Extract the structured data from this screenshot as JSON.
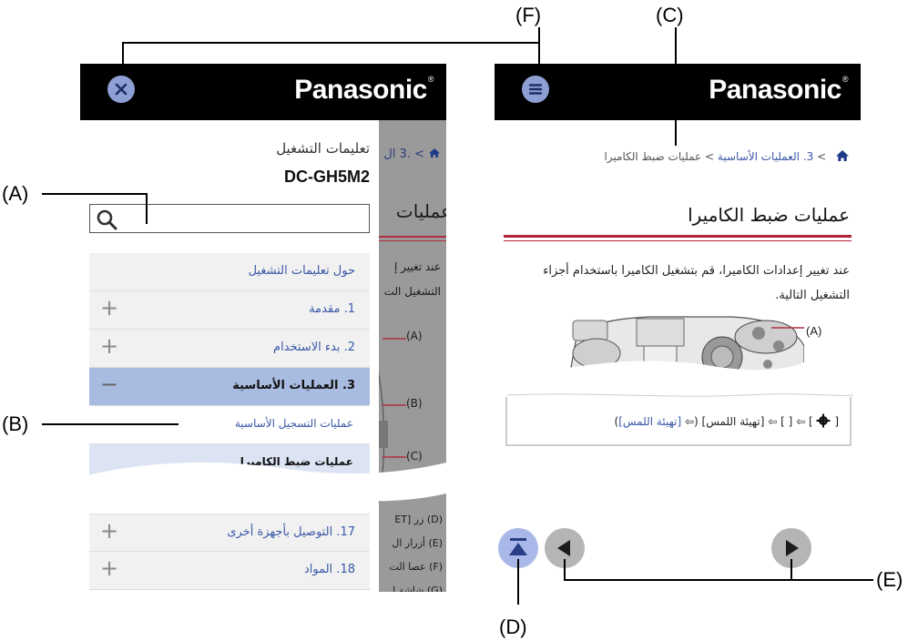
{
  "callouts": {
    "a": "(A)",
    "b": "(B)",
    "c": "(C)",
    "d": "(D)",
    "e": "(E)",
    "f": "(F)"
  },
  "brand": {
    "logo": "Panasonic",
    "mark": "®"
  },
  "drawer": {
    "title": "تعليمات التشغيل",
    "model": "DC-GH5M2",
    "menu": [
      {
        "label": "حول تعليمات التشغيل",
        "expander": ""
      },
      {
        "label": "1. مقدمة",
        "expander": "+"
      },
      {
        "label": "2. بدء الاستخدام",
        "expander": "+"
      },
      {
        "label": "3. العمليات الأساسية",
        "expander": "−"
      },
      {
        "label": "عمليات التسجيل الأساسية",
        "expander": ""
      },
      {
        "label": "عمليات ضبط الكاميرا",
        "expander": ""
      },
      {
        "label": "17. التوصيل بأجهزة أخرى",
        "expander": "+"
      },
      {
        "label": "18. المواد",
        "expander": "+"
      }
    ]
  },
  "left_background": {
    "crumb": "> .3 ال",
    "title": "عمليات",
    "line1": "عند تغيير إ",
    "line2": "التشغيل الت",
    "ann_a": "(A)",
    "ann_b": "(B)",
    "ann_c": "(C)",
    "item_d": "(D) زر [ET",
    "item_e": "(E) أزرار ال",
    "item_f": "(F) عصا الت",
    "item_g": "(G) شاشة ا"
  },
  "page": {
    "breadcrumb_link": "3. العمليات الأساسية",
    "breadcrumb_sep": ">",
    "breadcrumb_current": "عمليات ضبط الكاميرا",
    "title": "عمليات ضبط الكاميرا",
    "body_line1": "عند تغيير إعدادات الكاميرا، قم بتشغيل الكاميرا باستخدام أجزاء",
    "body_line2": "التشغيل التالية.",
    "annotation": "(A)",
    "path_prefix": "[",
    "path_text": "] ⇦ [ ] ⇦ [تهيئة اللمس] (⇦ ",
    "path_link": "[تهيئة اللمس]",
    "path_suffix": ")"
  },
  "colors": {
    "accent_blue": "#3a58a8",
    "button_blue": "#8e9fd4",
    "active_row": "#a8bbe0",
    "rule_red": "#b02537",
    "nav_gray": "#b5b5b5"
  },
  "icons": [
    "close-icon",
    "menu-icon",
    "search-icon",
    "home-icon",
    "gear-icon",
    "touch-icon",
    "back-to-top-icon",
    "previous-page-icon",
    "next-page-icon"
  ]
}
